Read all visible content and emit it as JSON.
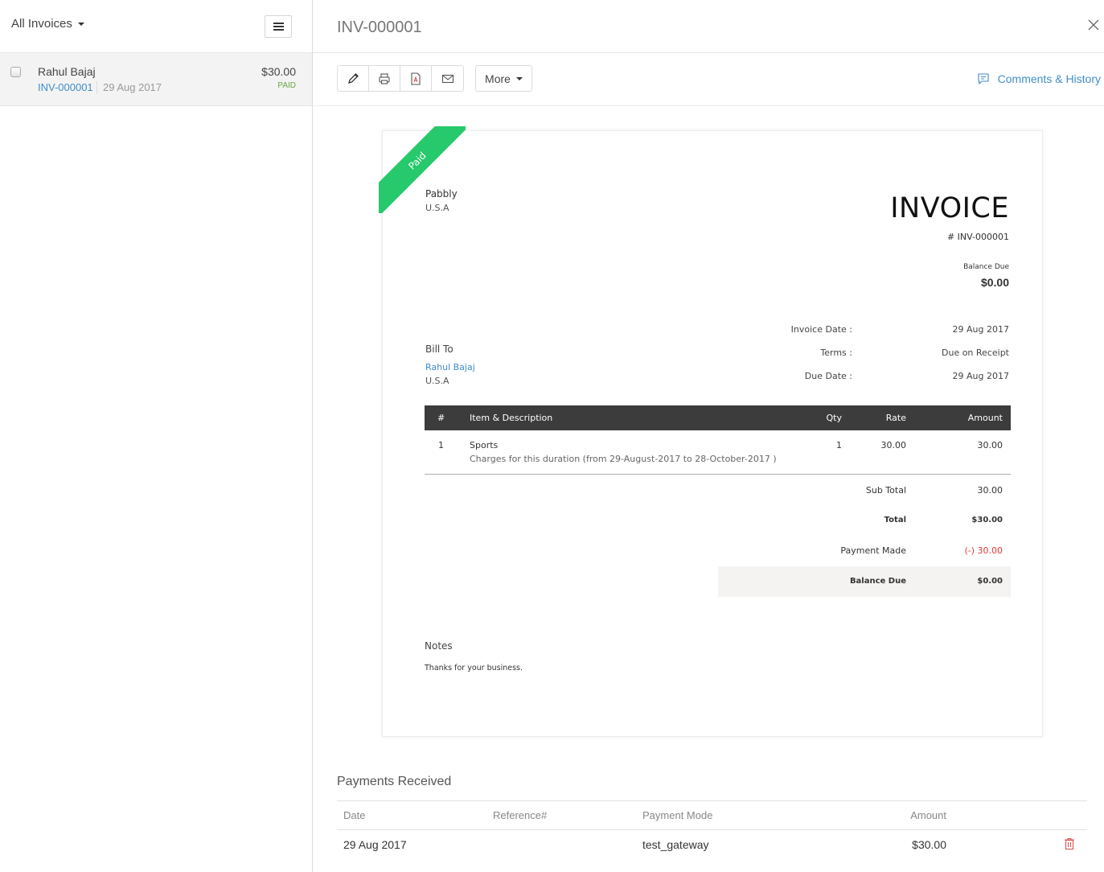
{
  "sidebar": {
    "filter_label": "All Invoices",
    "menu_icon": "hamburger-icon",
    "items": [
      {
        "customer": "Rahul Bajaj",
        "invoice_number": "INV-000001",
        "date": "29 Aug 2017",
        "amount": "$30.00",
        "status": "PAID",
        "status_color": "#6aa43f",
        "checked": false
      }
    ]
  },
  "header": {
    "title": "INV-000001",
    "close_icon": "close-icon"
  },
  "toolbar": {
    "icons": [
      "pencil-icon",
      "printer-icon",
      "pdf-icon",
      "mail-icon"
    ],
    "more_label": "More",
    "comments_label": "Comments & History"
  },
  "invoice": {
    "ribbon_label": "Paid",
    "ribbon_color": "#26c96b",
    "org_name": "Pabbly",
    "org_country": "U.S.A",
    "heading": "INVOICE",
    "number": "# INV-000001",
    "balance_due_label": "Balance Due",
    "balance_due_value": "$0.00",
    "meta": [
      {
        "label": "Invoice Date :",
        "value": "29 Aug 2017"
      },
      {
        "label": "Terms :",
        "value": "Due on Receipt"
      },
      {
        "label": "Due Date :",
        "value": "29 Aug 2017"
      }
    ],
    "bill_to_label": "Bill To",
    "bill_to_name": "Rahul Bajaj",
    "bill_to_country": "U.S.A",
    "table": {
      "headers": {
        "num": "#",
        "item": "Item & Description",
        "qty": "Qty",
        "rate": "Rate",
        "amount": "Amount"
      },
      "rows": [
        {
          "num": "1",
          "item": "Sports",
          "description": "Charges for this duration (from 29-August-2017 to 28-October-2017 )",
          "qty": "1",
          "rate": "30.00",
          "amount": "30.00"
        }
      ]
    },
    "totals": {
      "sub_total_label": "Sub Total",
      "sub_total_value": "30.00",
      "total_label": "Total",
      "total_value": "$30.00",
      "payment_made_label": "Payment Made",
      "payment_made_value": "(-) 30.00",
      "payment_made_color": "#e53935",
      "balance_due_label": "Balance Due",
      "balance_due_value": "$0.00"
    },
    "notes_label": "Notes",
    "notes_text": "Thanks for your business."
  },
  "payments": {
    "title": "Payments Received",
    "headers": {
      "date": "Date",
      "reference": "Reference#",
      "mode": "Payment Mode",
      "amount": "Amount"
    },
    "rows": [
      {
        "date": "29 Aug 2017",
        "reference": "",
        "mode": "test_gateway",
        "amount": "$30.00",
        "action_icon": "trash-icon"
      }
    ]
  }
}
